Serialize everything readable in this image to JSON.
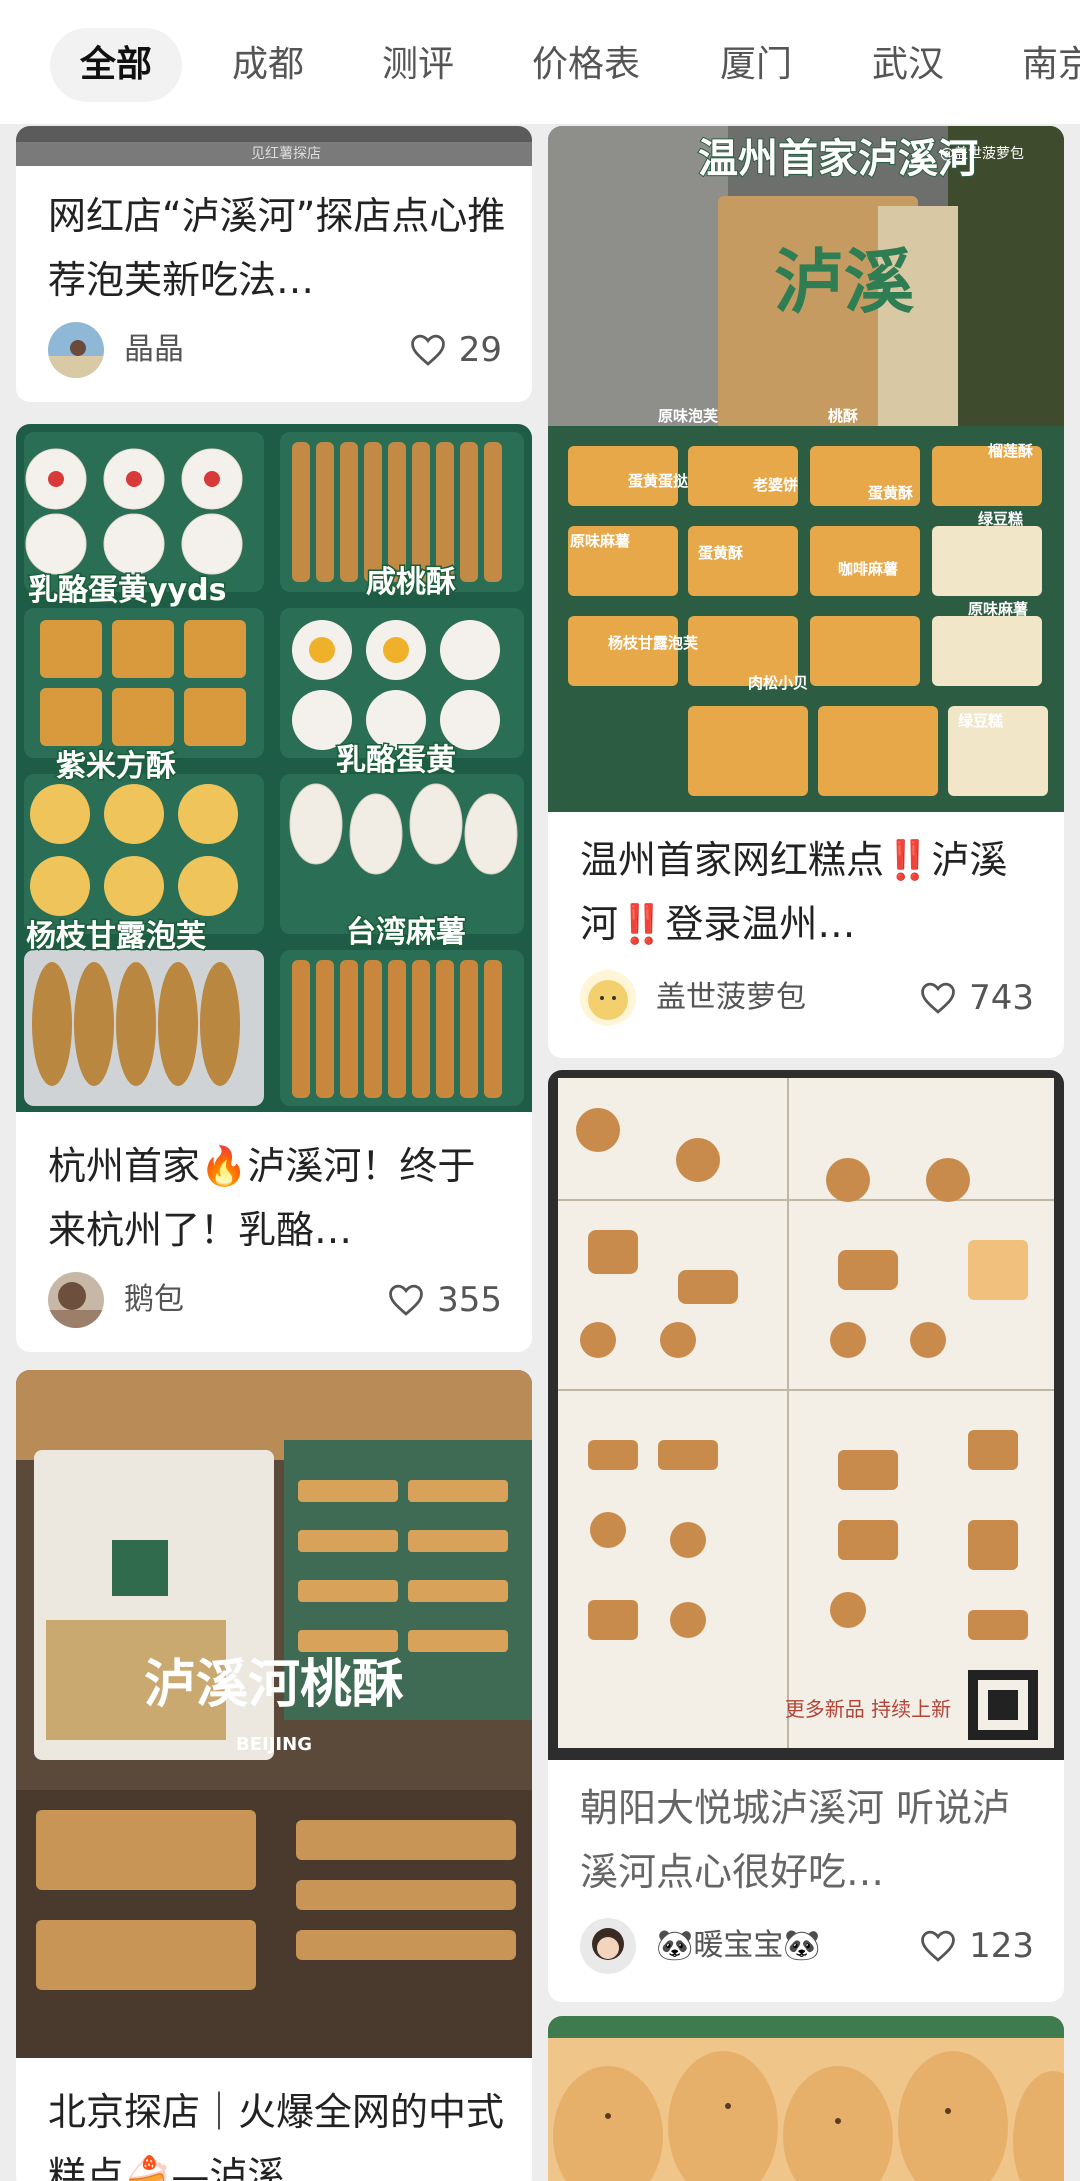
{
  "tabs": [
    "全部",
    "成都",
    "测评",
    "价格表",
    "厦门",
    "武汉",
    "南京"
  ],
  "colors": {
    "background": "#ededed",
    "card": "#ffffff",
    "text": "#222222",
    "accent_red": "#e53935",
    "fire": "#ff6a00"
  },
  "cards": [
    {
      "title": "网红店“泸溪河”探店点心推荐泡芙新吃法…",
      "author": "晶晶",
      "likes": "29",
      "image_caption": "",
      "image_watermark": "见红薯探店"
    },
    {
      "title": "杭州首家🔥泸溪河！终于来杭州了！乳酪…",
      "author": "鹅包",
      "likes": "355",
      "image_labels": [
        "乳酪蛋黄yyds",
        "咸桃酥",
        "紫米方酥",
        "乳酪蛋黄",
        "杨枝甘露泡芙",
        "台湾麻薯"
      ]
    },
    {
      "title": "北京探店｜火爆全网的中式糕点🍰—泸溪…",
      "author": "",
      "likes": "",
      "image_caption": "泸溪河桃酥",
      "image_subcaption": "BEIJING"
    },
    {
      "title": "温州首家网红糕点‼️泸溪河‼️登录温州…",
      "author": "盖世菠萝包",
      "likes": "743",
      "image_caption": "温州首家泸溪河",
      "image_watermark": "@盖世菠萝包",
      "image_bag_text": "泸溪",
      "image_labels": [
        "原味泡芙",
        "桃酥",
        "蛋黄蛋挞",
        "老婆饼",
        "蛋黄酥",
        "榴莲酥",
        "原味麻薯",
        "蛋黄酥",
        "咖啡麻薯",
        "绿豆糕",
        "杨枝甘露泡芙",
        "肉松小贝",
        "原味麻薯",
        "绿豆糕"
      ]
    },
    {
      "title": "朝阳大悦城泸溪河 听说泸溪河点心很好吃…",
      "author": "🐼暖宝宝🐼",
      "likes": "123",
      "image_caption": "更多新品 持续上新"
    }
  ]
}
